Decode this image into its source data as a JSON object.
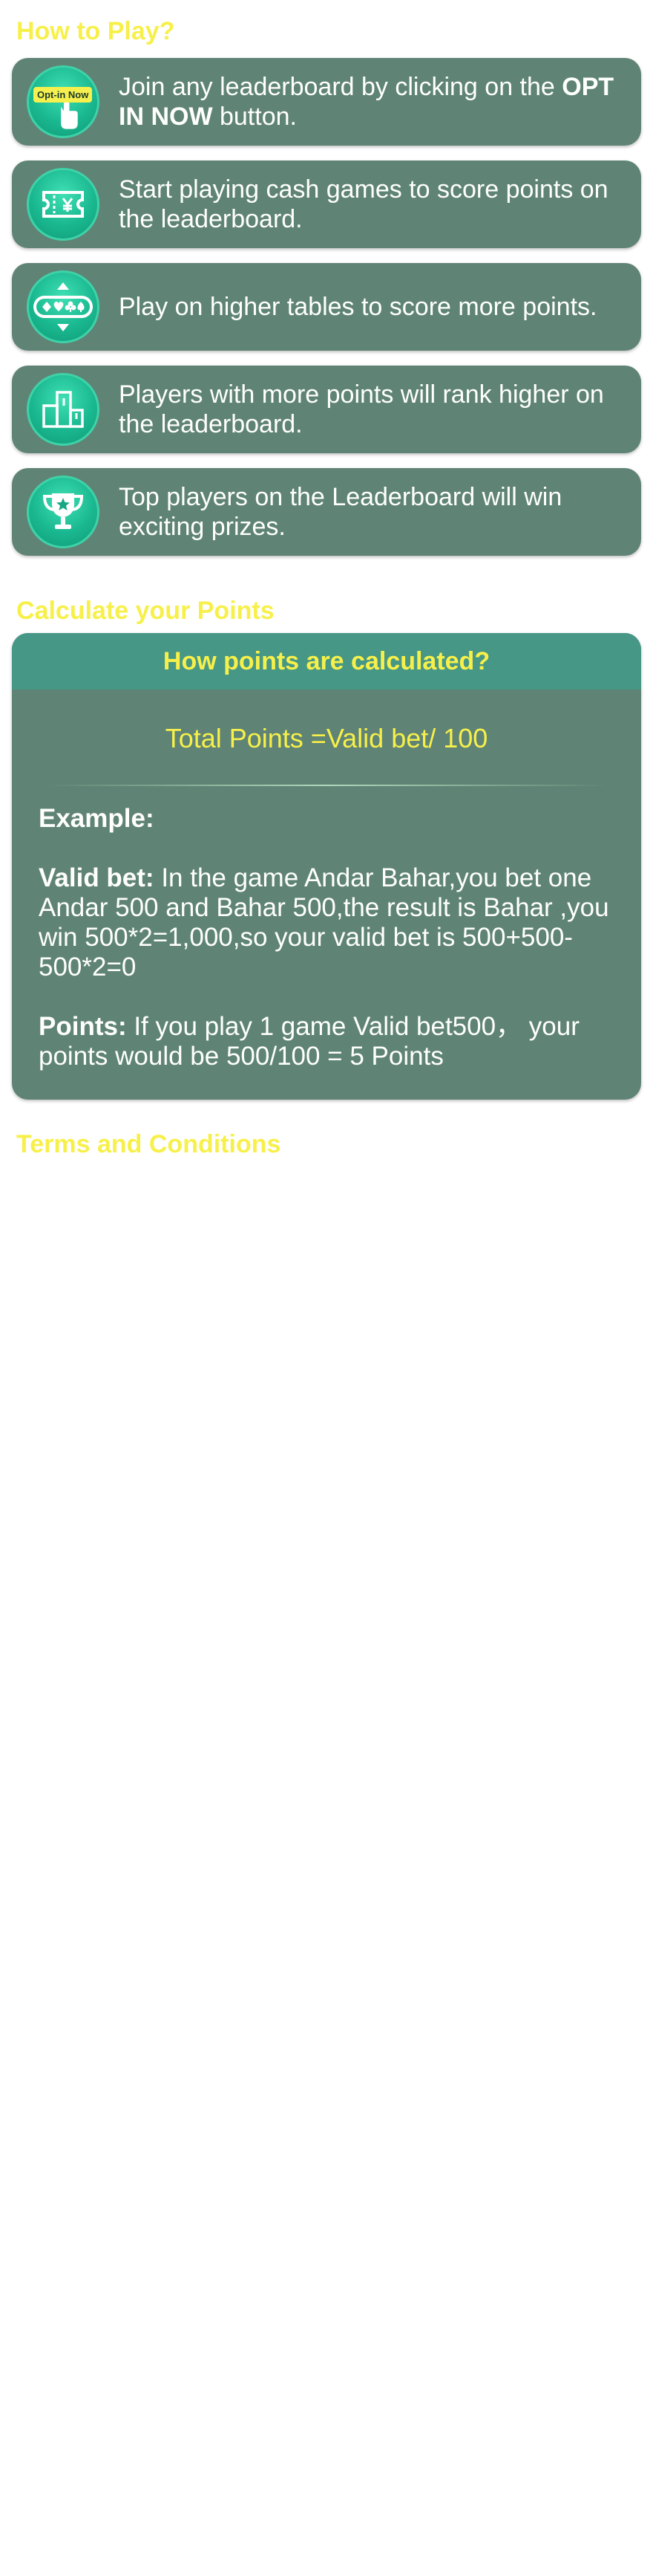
{
  "how_to_play": {
    "title": "How to Play?",
    "steps": [
      {
        "icon": "tap-hand-icon",
        "badge": "Opt-in Now",
        "text_pre": "Join any leaderboard by clicking on the ",
        "text_bold": "OPT IN NOW",
        "text_post": " button."
      },
      {
        "icon": "ticket-icon",
        "text": "Start playing cash games to score points on the leaderboard."
      },
      {
        "icon": "card-suits-icon",
        "text": "Play on higher tables to score more points."
      },
      {
        "icon": "podium-icon",
        "text": "Players with more points will rank higher on the leaderboard."
      },
      {
        "icon": "trophy-icon",
        "text": "Top players on the Leaderboard will win exciting prizes."
      }
    ]
  },
  "calculate": {
    "title": "Calculate your Points",
    "header": "How points are calculated?",
    "formula": "Total Points =Valid bet/ 100",
    "example_label": "Example:",
    "valid_bet_label": "Valid bet:",
    "valid_bet_text": " In the game Andar Bahar,you bet one Andar 500 and Bahar 500,the result is Bahar ,you win 500*2=1,000,so your valid bet is 500+500-500*2=0",
    "points_label": "Points:",
    "points_text": " If you play 1 game Valid bet500， your points would be 500/100 = 5 Points"
  },
  "terms": {
    "title": "Terms and Conditions"
  },
  "colors": {
    "accent_yellow": "#f7f04a",
    "card_bg": "#5f8475",
    "header_bg": "#469786",
    "icon_green": "#1ab890"
  }
}
